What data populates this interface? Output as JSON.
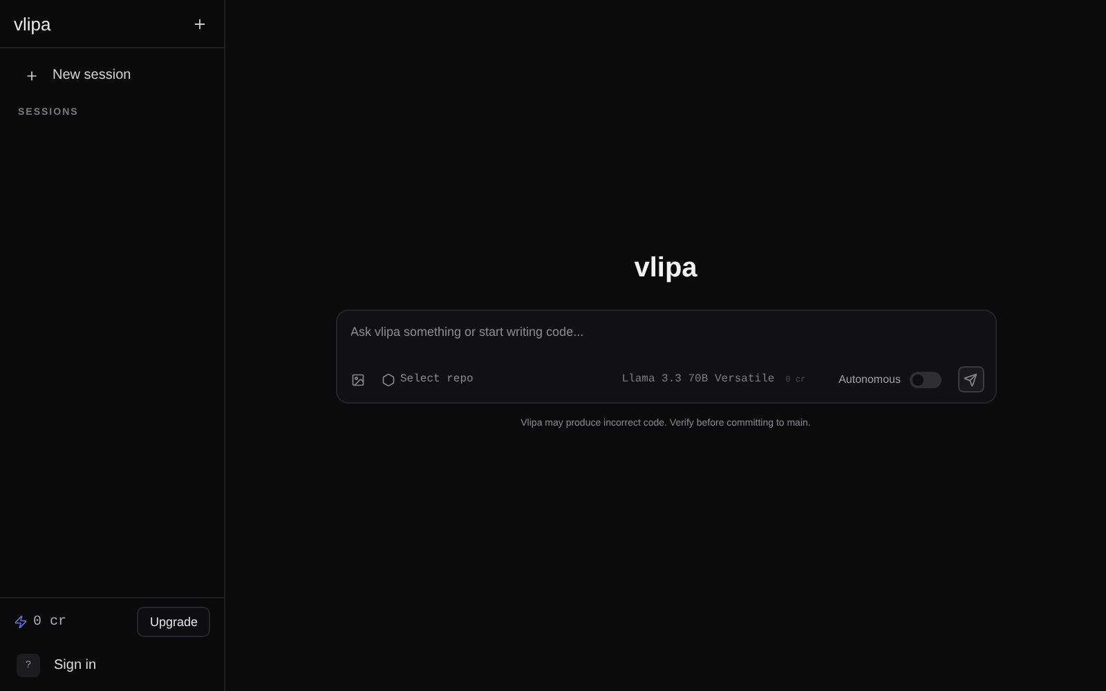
{
  "sidebar": {
    "title": "vlipa",
    "new_session": "New session",
    "section_label": "SESSIONS",
    "credits": "0 cr",
    "upgrade": "Upgrade",
    "sign_in": {
      "avatar": "?",
      "label": "Sign in"
    }
  },
  "main": {
    "title": "vlipa",
    "composer": {
      "placeholder": "Ask vlipa something or start writing code...",
      "repo": "Select repo",
      "model": "Llama 3.3 70B Versatile",
      "model_cost": "0 cr",
      "autonomous": {
        "label": "Autonomous",
        "on": false
      }
    },
    "disclaimer": "Vlipa may produce incorrect code. Verify before committing to main."
  }
}
